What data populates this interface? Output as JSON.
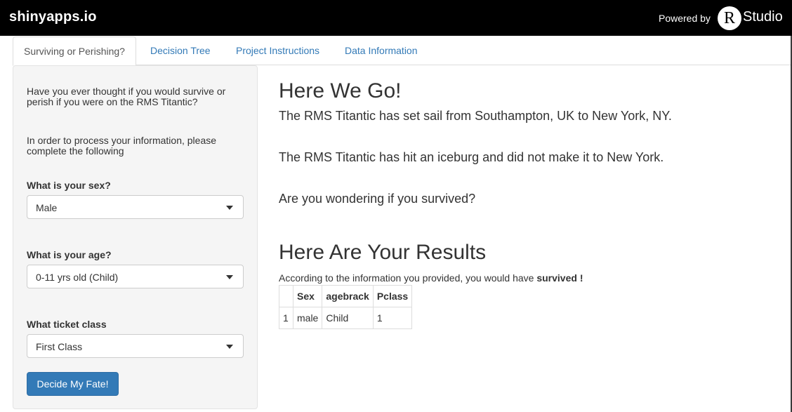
{
  "header": {
    "brand": "shinyapps.io",
    "powered_by": "Powered by",
    "rstudio_r": "R",
    "rstudio_studio": "Studio"
  },
  "tabs": [
    {
      "label": "Surviving or Perishing?",
      "active": true
    },
    {
      "label": "Decision Tree",
      "active": false
    },
    {
      "label": "Project Instructions",
      "active": false
    },
    {
      "label": "Data Information",
      "active": false
    }
  ],
  "sidebar": {
    "intro": "Have you ever thought if you would survive or perish if you were on the RMS Titantic?",
    "instructions": "In order to process your information, please complete the following",
    "sex": {
      "label": "What is your sex?",
      "value": "Male"
    },
    "age": {
      "label": "What is your age?",
      "value": "0-11 yrs old (Child)"
    },
    "class": {
      "label": "What ticket class",
      "value": "First Class"
    },
    "button": "Decide My Fate!"
  },
  "main": {
    "heading1": "Here We Go!",
    "line1": "The RMS Titantic has set sail from Southampton, UK to New York, NY.",
    "line2": "The RMS Titantic has hit an iceburg and did not make it to New York.",
    "line3": "Are you wondering if you survived?",
    "heading2": "Here Are Your Results",
    "result_prefix": "According to the information you provided, you would have",
    "result_value": "survived",
    "result_suffix": "!",
    "table": {
      "headers": [
        "",
        "Sex",
        "agebrack",
        "Pclass"
      ],
      "rows": [
        [
          "1",
          "male",
          "Child",
          "1"
        ]
      ]
    }
  }
}
